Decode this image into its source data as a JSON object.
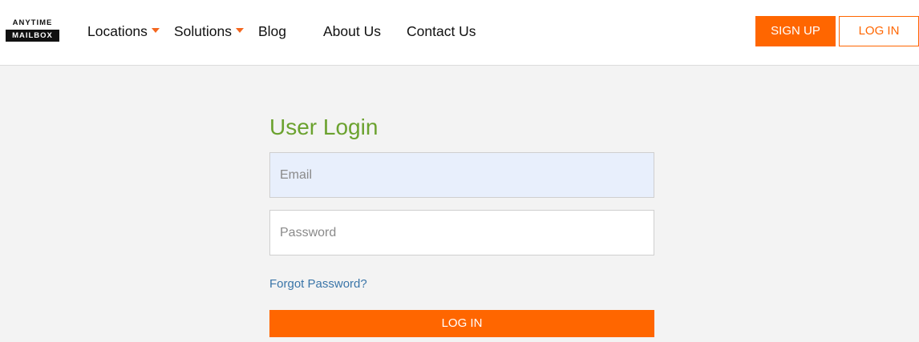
{
  "header": {
    "logo": {
      "line1": "ANYTIME",
      "line2": "MAILBOX"
    },
    "nav": [
      {
        "label": "Locations",
        "has_dropdown": true
      },
      {
        "label": "Solutions",
        "has_dropdown": true
      },
      {
        "label": "Blog",
        "has_dropdown": false
      },
      {
        "label": "About Us",
        "has_dropdown": false
      },
      {
        "label": "Contact Us",
        "has_dropdown": false
      }
    ],
    "signup_label": "SIGN UP",
    "login_label": "LOG IN"
  },
  "login": {
    "title": "User Login",
    "email_placeholder": "Email",
    "email_value": "",
    "password_placeholder": "Password",
    "password_value": "",
    "forgot_label": "Forgot Password?",
    "submit_label": "LOG IN"
  },
  "colors": {
    "accent": "#ff6600",
    "title_green": "#6ba22f",
    "link_blue": "#3a75a8",
    "page_bg": "#f3f3f3",
    "email_field_bg": "#e8effc"
  },
  "icons": {
    "dropdown": "caret-down-icon"
  }
}
